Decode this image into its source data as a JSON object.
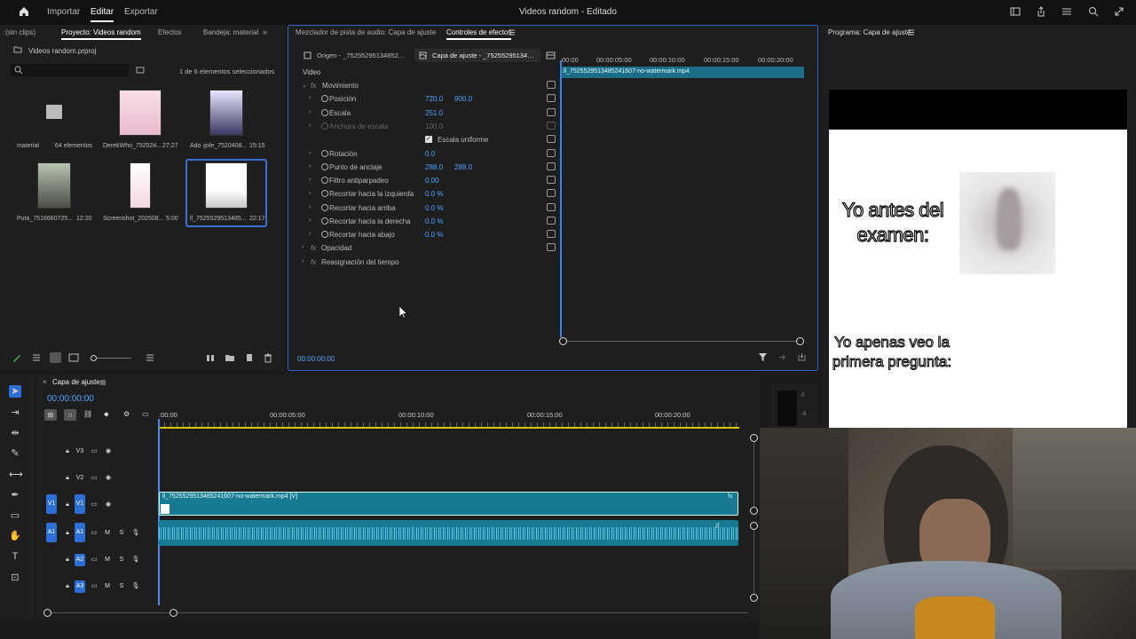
{
  "app": {
    "nav": [
      "Importar",
      "Editar",
      "Exportar"
    ],
    "active_nav": "Editar",
    "title": "Videos random - Editado"
  },
  "project_panel": {
    "tabs": [
      ":(sin clips)",
      "Proyecto: Videos random",
      "Efectos",
      "Bandeja: material"
    ],
    "project_file": "Videos random.prproj",
    "selection_info": "1 de 6 elementos seleccionados",
    "items": [
      {
        "name": "material",
        "meta": "64 elementos"
      },
      {
        "name": "DerekWho_752524...",
        "meta": "27:27"
      },
      {
        "name": "Ado ıjole_7520408...",
        "meta": "15:15"
      },
      {
        "name": "Puta_7516660725...",
        "meta": "12:20"
      },
      {
        "name": "Screenshot_202508...",
        "meta": "5:00"
      },
      {
        "name": "ll_7525529513485...",
        "meta": "22:17"
      }
    ]
  },
  "effects_panel": {
    "tabs": [
      "Mezclador de pista de audio: Capa de ajuste",
      "Controles de efectos"
    ],
    "source_tabs": [
      "Origen - _75255295134852…",
      "Capa de ajuste - _75255295134…"
    ],
    "section": "Video",
    "rows": [
      {
        "name": "Movimiento",
        "fx": true
      },
      {
        "name": "Posición",
        "v1": "720.0",
        "v2": "900.0"
      },
      {
        "name": "Escala",
        "v1": "251.0"
      },
      {
        "name": "Anchura de escala",
        "v1": "100.0",
        "disabled": true
      },
      {
        "name": "Escala uniforme",
        "checkbox": true
      },
      {
        "name": "Rotación",
        "v1": "0.0"
      },
      {
        "name": "Punto de anclaje",
        "v1": "288.0",
        "v2": "288.0"
      },
      {
        "name": "Filtro antiparpadeo",
        "v1": "0.00"
      },
      {
        "name": "Recortar hacia la izquierda",
        "v1": "0.0 %"
      },
      {
        "name": "Recortar hacia arriba",
        "v1": "0.0 %"
      },
      {
        "name": "Recortar hacia la derecha",
        "v1": "0.0 %"
      },
      {
        "name": "Recortar hacia abajo",
        "v1": "0.0 %"
      },
      {
        "name": "Opacidad",
        "fx": true
      },
      {
        "name": "Reasignación del tiempo",
        "fx": true
      }
    ],
    "mini_ruler": [
      "00:00",
      "00:00:05:00",
      "00:00:10:00",
      "00:00:15:00",
      "00:00:20:00"
    ],
    "clip_name": "ll_7525529513485241607-no-watermark.mp4",
    "timecode": "00:00:00:00"
  },
  "program_monitor": {
    "title": "Programa: Capa de ajuste",
    "caption_top": "Yo antes del examen:",
    "caption_bottom": "Yo apenas veo la primera pregunta:"
  },
  "timeline": {
    "sequence": "Capa de ajuste",
    "timecode": "00:00:00:00",
    "ruler": [
      ":00:00",
      "00:00:05:00",
      "00:00:10:00",
      "00:00:15:00",
      "00:00:20:00"
    ],
    "video_tracks": [
      "V3",
      "V2",
      "V1"
    ],
    "audio_tracks": [
      "A1",
      "A2",
      "A3"
    ],
    "clip_label": "ll_7525529513485241607-no-watermark.mp4 [V]",
    "mute": "M",
    "solo": "S",
    "meter_labels": [
      "0",
      "-6"
    ]
  }
}
